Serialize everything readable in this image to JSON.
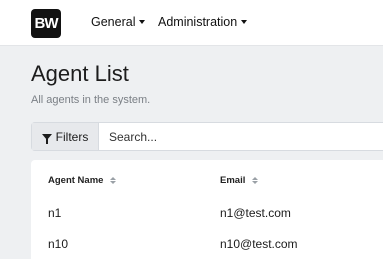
{
  "brand": {
    "logo_text": "BW"
  },
  "nav": {
    "items": [
      {
        "label": "General"
      },
      {
        "label": "Administration"
      }
    ]
  },
  "page": {
    "title": "Agent List",
    "subtitle": "All agents in the system."
  },
  "filters": {
    "button_label": "Filters",
    "search_placeholder": "Search..."
  },
  "table": {
    "columns": [
      "Agent Name",
      "Email"
    ],
    "rows": [
      {
        "name": "n1",
        "email": "n1@test.com"
      },
      {
        "name": "n10",
        "email": "n10@test.com"
      }
    ]
  }
}
